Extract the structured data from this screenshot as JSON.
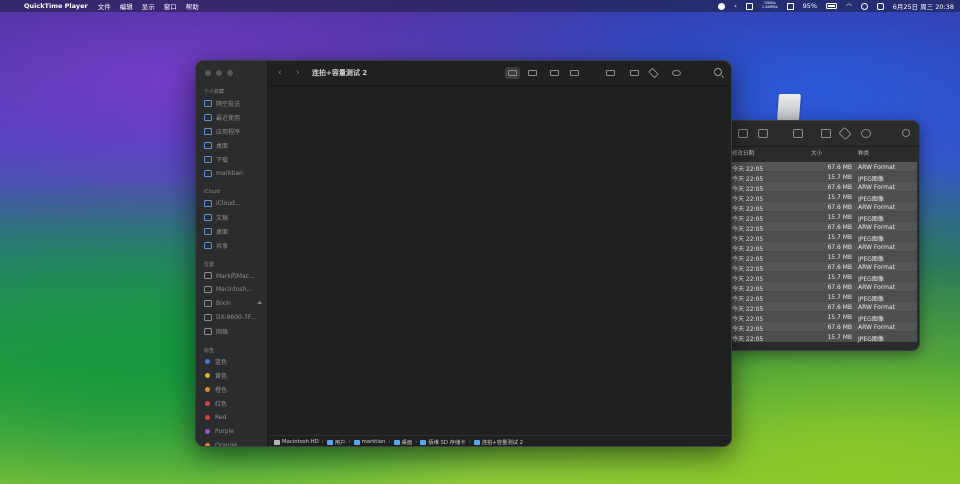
{
  "menubar": {
    "app_name": "QuickTime Player",
    "menus": [
      "文件",
      "编辑",
      "显示",
      "窗口",
      "帮助"
    ],
    "net_up": "72KB/s",
    "net_down": "1.50MB/s",
    "battery": "95%",
    "datetime": "6月25日 周三 20:38"
  },
  "front_window": {
    "title": "连拍+容量测试 2",
    "sidebar": {
      "favorites_header": "个人收藏",
      "favorites": [
        {
          "label": "隔空投送",
          "icon": "airdrop-icon"
        },
        {
          "label": "最近使用",
          "icon": "clock-icon"
        },
        {
          "label": "应用程序",
          "icon": "applications-icon"
        },
        {
          "label": "桌面",
          "icon": "desktop-icon"
        },
        {
          "label": "下载",
          "icon": "download-icon"
        },
        {
          "label": "marktian",
          "icon": "home-icon"
        }
      ],
      "icloud_header": "iCloud",
      "icloud": [
        {
          "label": "iCloud...",
          "icon": "icloud-icon"
        },
        {
          "label": "文稿",
          "icon": "document-icon"
        },
        {
          "label": "桌面",
          "icon": "desktop-icon"
        },
        {
          "label": "共享",
          "icon": "shared-icon"
        }
      ],
      "locations_header": "位置",
      "locations": [
        {
          "label": "Mark的Mac...",
          "icon": "computer-icon"
        },
        {
          "label": "Macintosh...",
          "icon": "disk-icon"
        },
        {
          "label": "Bixin",
          "icon": "disk-icon"
        },
        {
          "label": "DX-9600-7F...",
          "icon": "disk-icon"
        },
        {
          "label": "网络",
          "icon": "network-icon"
        }
      ],
      "tags_header": "标签",
      "tags": [
        {
          "label": "蓝色",
          "color": "#3b7ae0"
        },
        {
          "label": "黄色",
          "color": "#d9b52c"
        },
        {
          "label": "橙色",
          "color": "#e08a2c"
        },
        {
          "label": "红色",
          "color": "#d94040"
        },
        {
          "label": "Red",
          "color": "#d94040"
        },
        {
          "label": "Purple",
          "color": "#9a55cc"
        },
        {
          "label": "Orange",
          "color": "#e08a2c"
        }
      ]
    },
    "path": [
      "Macintosh HD",
      "用户",
      "marktian",
      "桌面",
      "佰维 SD 存储卡",
      "连拍+容量测试 2"
    ]
  },
  "back_window": {
    "columns": {
      "date": "修改日期",
      "size": "大小",
      "kind": "种类"
    },
    "rows": [
      {
        "date": "今天 22:05",
        "size": "67.6 MB",
        "kind": "ARW Format"
      },
      {
        "date": "今天 22:05",
        "size": "15.7 MB",
        "kind": "JPEG图像"
      },
      {
        "date": "今天 22:05",
        "size": "67.6 MB",
        "kind": "ARW Format"
      },
      {
        "date": "今天 22:05",
        "size": "15.7 MB",
        "kind": "JPEG图像"
      },
      {
        "date": "今天 22:05",
        "size": "67.6 MB",
        "kind": "ARW Format"
      },
      {
        "date": "今天 22:05",
        "size": "15.7 MB",
        "kind": "JPEG图像"
      },
      {
        "date": "今天 22:05",
        "size": "67.6 MB",
        "kind": "ARW Format"
      },
      {
        "date": "今天 22:05",
        "size": "15.7 MB",
        "kind": "JPEG图像"
      },
      {
        "date": "今天 22:05",
        "size": "67.6 MB",
        "kind": "ARW Format"
      },
      {
        "date": "今天 22:05",
        "size": "15.7 MB",
        "kind": "JPEG图像"
      },
      {
        "date": "今天 22:05",
        "size": "67.6 MB",
        "kind": "ARW Format"
      },
      {
        "date": "今天 22:05",
        "size": "15.7 MB",
        "kind": "JPEG图像"
      },
      {
        "date": "今天 22:05",
        "size": "67.6 MB",
        "kind": "ARW Format"
      },
      {
        "date": "今天 22:05",
        "size": "15.7 MB",
        "kind": "JPEG图像"
      },
      {
        "date": "今天 22:05",
        "size": "67.6 MB",
        "kind": "ARW Format"
      },
      {
        "date": "今天 22:05",
        "size": "15.7 MB",
        "kind": "JPEG图像"
      },
      {
        "date": "今天 22:05",
        "size": "67.6 MB",
        "kind": "ARW Format"
      },
      {
        "date": "今天 22:05",
        "size": "15.7 MB",
        "kind": "JPEG图像"
      }
    ]
  }
}
